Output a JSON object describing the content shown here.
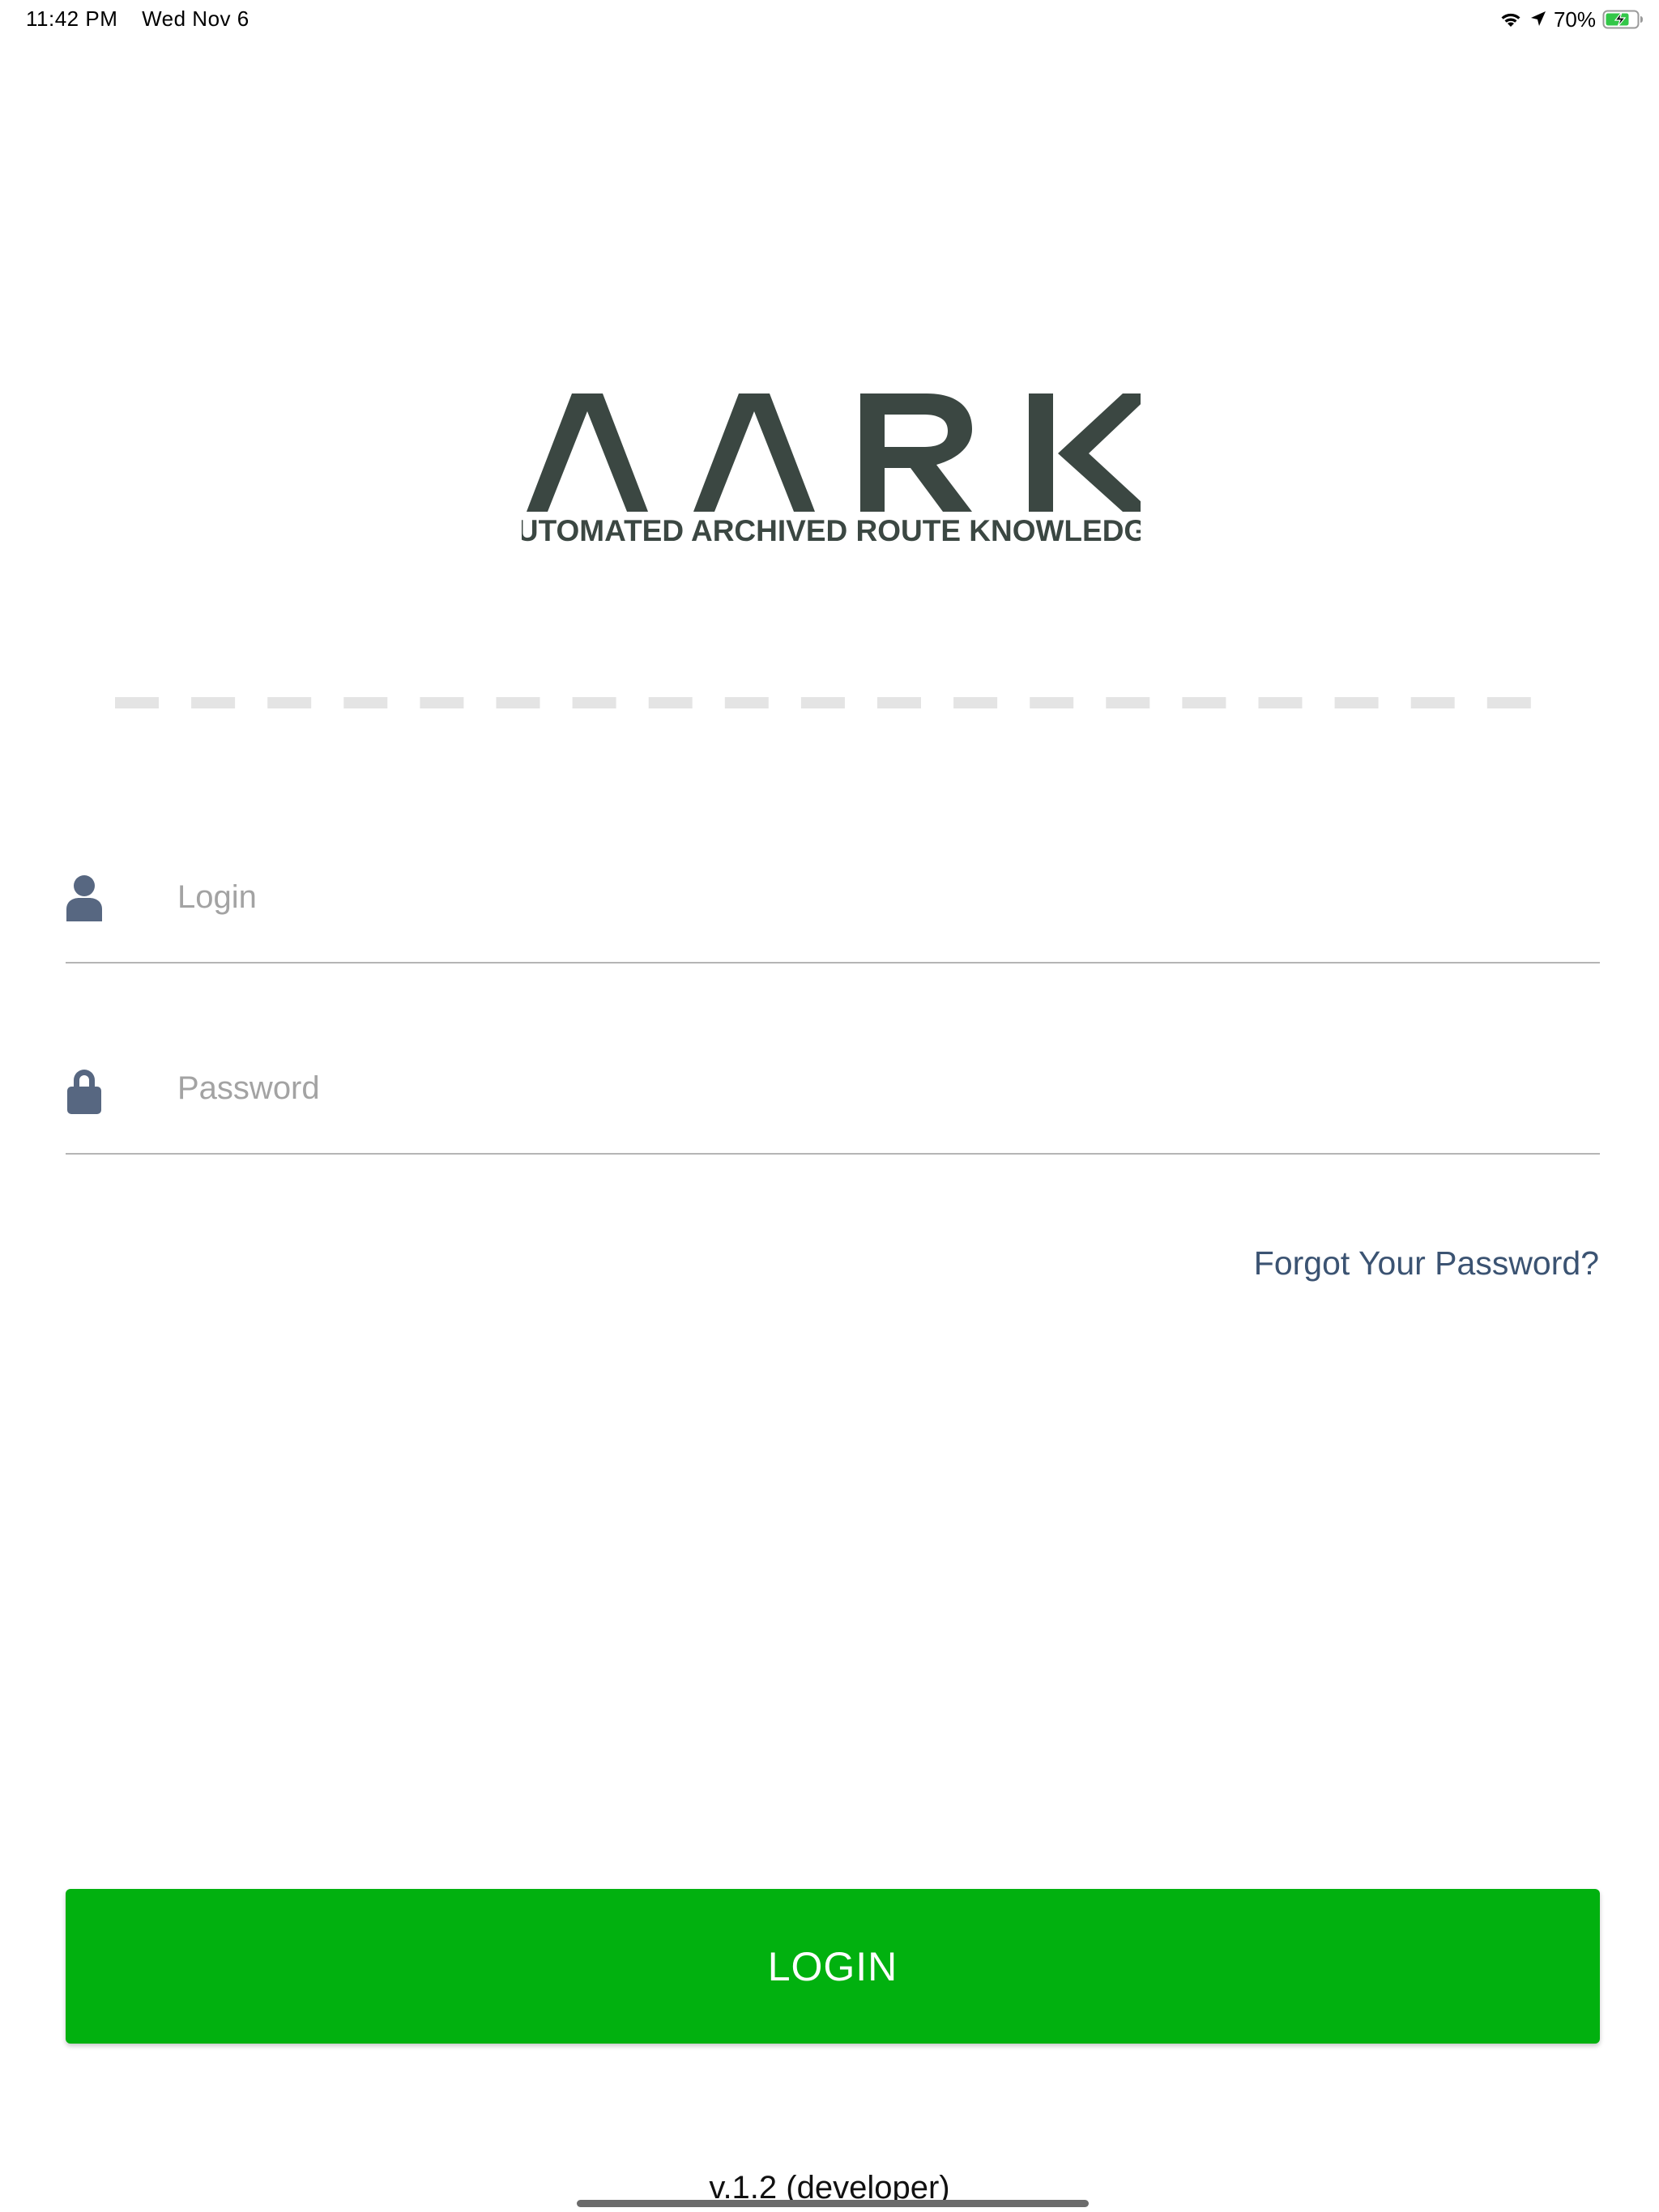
{
  "status_bar": {
    "time": "11:42 PM",
    "date": "Wed Nov 6",
    "battery_percent": "70%",
    "icons": [
      "wifi-icon",
      "location-arrow-icon",
      "battery-charging-icon"
    ]
  },
  "logo": {
    "wordmark": "AARK",
    "tagline": "AUTOMATED ARCHIVED ROUTE KNOWLEDGE",
    "color": "#3b4742"
  },
  "loader": {
    "segments": 19,
    "color": "#e4e4e4"
  },
  "login_field": {
    "icon": "user-icon",
    "placeholder": "Login",
    "value": ""
  },
  "password_field": {
    "icon": "lock-icon",
    "placeholder": "Password",
    "value": ""
  },
  "forgot_password": {
    "label": "Forgot Your Password?",
    "color": "#3b5372"
  },
  "login_button": {
    "label": "LOGIN",
    "color": "#01b10f"
  },
  "version": "v.1.2 (developer)",
  "icon_color": "#576781"
}
